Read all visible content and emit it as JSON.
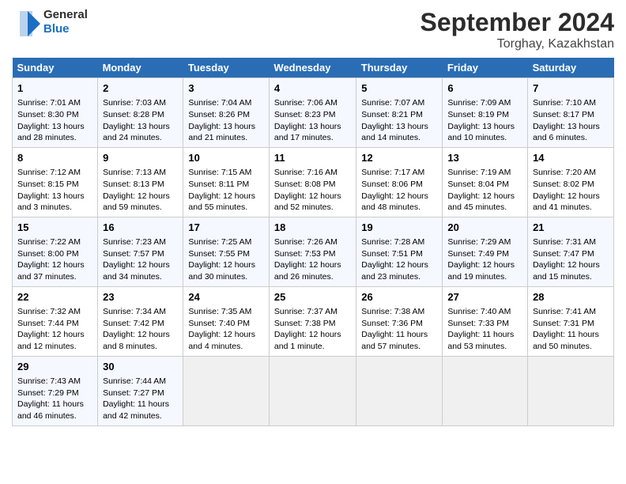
{
  "header": {
    "logo_line1": "General",
    "logo_line2": "Blue",
    "month": "September 2024",
    "location": "Torghay, Kazakhstan"
  },
  "days_of_week": [
    "Sunday",
    "Monday",
    "Tuesday",
    "Wednesday",
    "Thursday",
    "Friday",
    "Saturday"
  ],
  "weeks": [
    [
      {
        "day": "1",
        "sunrise": "Sunrise: 7:01 AM",
        "sunset": "Sunset: 8:30 PM",
        "daylight": "Daylight: 13 hours and 28 minutes."
      },
      {
        "day": "2",
        "sunrise": "Sunrise: 7:03 AM",
        "sunset": "Sunset: 8:28 PM",
        "daylight": "Daylight: 13 hours and 24 minutes."
      },
      {
        "day": "3",
        "sunrise": "Sunrise: 7:04 AM",
        "sunset": "Sunset: 8:26 PM",
        "daylight": "Daylight: 13 hours and 21 minutes."
      },
      {
        "day": "4",
        "sunrise": "Sunrise: 7:06 AM",
        "sunset": "Sunset: 8:23 PM",
        "daylight": "Daylight: 13 hours and 17 minutes."
      },
      {
        "day": "5",
        "sunrise": "Sunrise: 7:07 AM",
        "sunset": "Sunset: 8:21 PM",
        "daylight": "Daylight: 13 hours and 14 minutes."
      },
      {
        "day": "6",
        "sunrise": "Sunrise: 7:09 AM",
        "sunset": "Sunset: 8:19 PM",
        "daylight": "Daylight: 13 hours and 10 minutes."
      },
      {
        "day": "7",
        "sunrise": "Sunrise: 7:10 AM",
        "sunset": "Sunset: 8:17 PM",
        "daylight": "Daylight: 13 hours and 6 minutes."
      }
    ],
    [
      {
        "day": "8",
        "sunrise": "Sunrise: 7:12 AM",
        "sunset": "Sunset: 8:15 PM",
        "daylight": "Daylight: 13 hours and 3 minutes."
      },
      {
        "day": "9",
        "sunrise": "Sunrise: 7:13 AM",
        "sunset": "Sunset: 8:13 PM",
        "daylight": "Daylight: 12 hours and 59 minutes."
      },
      {
        "day": "10",
        "sunrise": "Sunrise: 7:15 AM",
        "sunset": "Sunset: 8:11 PM",
        "daylight": "Daylight: 12 hours and 55 minutes."
      },
      {
        "day": "11",
        "sunrise": "Sunrise: 7:16 AM",
        "sunset": "Sunset: 8:08 PM",
        "daylight": "Daylight: 12 hours and 52 minutes."
      },
      {
        "day": "12",
        "sunrise": "Sunrise: 7:17 AM",
        "sunset": "Sunset: 8:06 PM",
        "daylight": "Daylight: 12 hours and 48 minutes."
      },
      {
        "day": "13",
        "sunrise": "Sunrise: 7:19 AM",
        "sunset": "Sunset: 8:04 PM",
        "daylight": "Daylight: 12 hours and 45 minutes."
      },
      {
        "day": "14",
        "sunrise": "Sunrise: 7:20 AM",
        "sunset": "Sunset: 8:02 PM",
        "daylight": "Daylight: 12 hours and 41 minutes."
      }
    ],
    [
      {
        "day": "15",
        "sunrise": "Sunrise: 7:22 AM",
        "sunset": "Sunset: 8:00 PM",
        "daylight": "Daylight: 12 hours and 37 minutes."
      },
      {
        "day": "16",
        "sunrise": "Sunrise: 7:23 AM",
        "sunset": "Sunset: 7:57 PM",
        "daylight": "Daylight: 12 hours and 34 minutes."
      },
      {
        "day": "17",
        "sunrise": "Sunrise: 7:25 AM",
        "sunset": "Sunset: 7:55 PM",
        "daylight": "Daylight: 12 hours and 30 minutes."
      },
      {
        "day": "18",
        "sunrise": "Sunrise: 7:26 AM",
        "sunset": "Sunset: 7:53 PM",
        "daylight": "Daylight: 12 hours and 26 minutes."
      },
      {
        "day": "19",
        "sunrise": "Sunrise: 7:28 AM",
        "sunset": "Sunset: 7:51 PM",
        "daylight": "Daylight: 12 hours and 23 minutes."
      },
      {
        "day": "20",
        "sunrise": "Sunrise: 7:29 AM",
        "sunset": "Sunset: 7:49 PM",
        "daylight": "Daylight: 12 hours and 19 minutes."
      },
      {
        "day": "21",
        "sunrise": "Sunrise: 7:31 AM",
        "sunset": "Sunset: 7:47 PM",
        "daylight": "Daylight: 12 hours and 15 minutes."
      }
    ],
    [
      {
        "day": "22",
        "sunrise": "Sunrise: 7:32 AM",
        "sunset": "Sunset: 7:44 PM",
        "daylight": "Daylight: 12 hours and 12 minutes."
      },
      {
        "day": "23",
        "sunrise": "Sunrise: 7:34 AM",
        "sunset": "Sunset: 7:42 PM",
        "daylight": "Daylight: 12 hours and 8 minutes."
      },
      {
        "day": "24",
        "sunrise": "Sunrise: 7:35 AM",
        "sunset": "Sunset: 7:40 PM",
        "daylight": "Daylight: 12 hours and 4 minutes."
      },
      {
        "day": "25",
        "sunrise": "Sunrise: 7:37 AM",
        "sunset": "Sunset: 7:38 PM",
        "daylight": "Daylight: 12 hours and 1 minute."
      },
      {
        "day": "26",
        "sunrise": "Sunrise: 7:38 AM",
        "sunset": "Sunset: 7:36 PM",
        "daylight": "Daylight: 11 hours and 57 minutes."
      },
      {
        "day": "27",
        "sunrise": "Sunrise: 7:40 AM",
        "sunset": "Sunset: 7:33 PM",
        "daylight": "Daylight: 11 hours and 53 minutes."
      },
      {
        "day": "28",
        "sunrise": "Sunrise: 7:41 AM",
        "sunset": "Sunset: 7:31 PM",
        "daylight": "Daylight: 11 hours and 50 minutes."
      }
    ],
    [
      {
        "day": "29",
        "sunrise": "Sunrise: 7:43 AM",
        "sunset": "Sunset: 7:29 PM",
        "daylight": "Daylight: 11 hours and 46 minutes."
      },
      {
        "day": "30",
        "sunrise": "Sunrise: 7:44 AM",
        "sunset": "Sunset: 7:27 PM",
        "daylight": "Daylight: 11 hours and 42 minutes."
      },
      null,
      null,
      null,
      null,
      null
    ]
  ]
}
